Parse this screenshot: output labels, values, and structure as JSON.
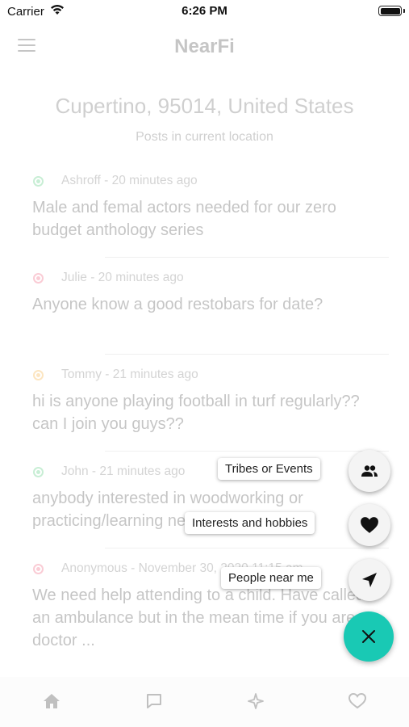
{
  "status_bar": {
    "carrier": "Carrier",
    "time": "6:26 PM"
  },
  "header": {
    "title": "NearFi",
    "menu_icon": "hamburger-menu-icon"
  },
  "location": {
    "name": "Cupertino, 95014, United States",
    "subtitle": "Posts in current location"
  },
  "posts": [
    {
      "author": "Ashroff",
      "time": "20 minutes ago",
      "text": "Male and femal actors needed for our zero budget anthology series",
      "dot_color": "#3cc46a"
    },
    {
      "author": "Julie",
      "time": "20 minutes ago",
      "text": "Anyone know a good restobars for date?",
      "dot_color": "#f04a6a"
    },
    {
      "author": "Tommy",
      "time": "21 minutes ago",
      "text": "hi is anyone playing football in turf regularly?? can I join you guys??",
      "dot_color": "#f5a623"
    },
    {
      "author": "John",
      "time": "21 minutes ago",
      "text": "anybody interested in woodworking or practicing/learning new crafts?",
      "dot_color": "#3cc46a"
    },
    {
      "author": "Anonymous",
      "time": "November 30, 2020 11:15 am",
      "text": "We need help attending to a child. Have called an ambulance but in the mean time if you are a doctor ...",
      "dot_color": "#f04a6a"
    }
  ],
  "meta_separator": " - ",
  "tabs": [
    {
      "icon": "home-icon"
    },
    {
      "icon": "chat-icon"
    },
    {
      "icon": "sparkle-icon"
    },
    {
      "icon": "heart-outline-icon"
    }
  ],
  "fab_actions": [
    {
      "label": "Tribes or Events",
      "icon": "group-icon"
    },
    {
      "label": "Interests and hobbies",
      "icon": "heart-icon"
    },
    {
      "label": "People near me",
      "icon": "navigation-arrow-icon"
    }
  ],
  "fab_main": {
    "icon": "close-icon",
    "color": "#19c9b4"
  }
}
